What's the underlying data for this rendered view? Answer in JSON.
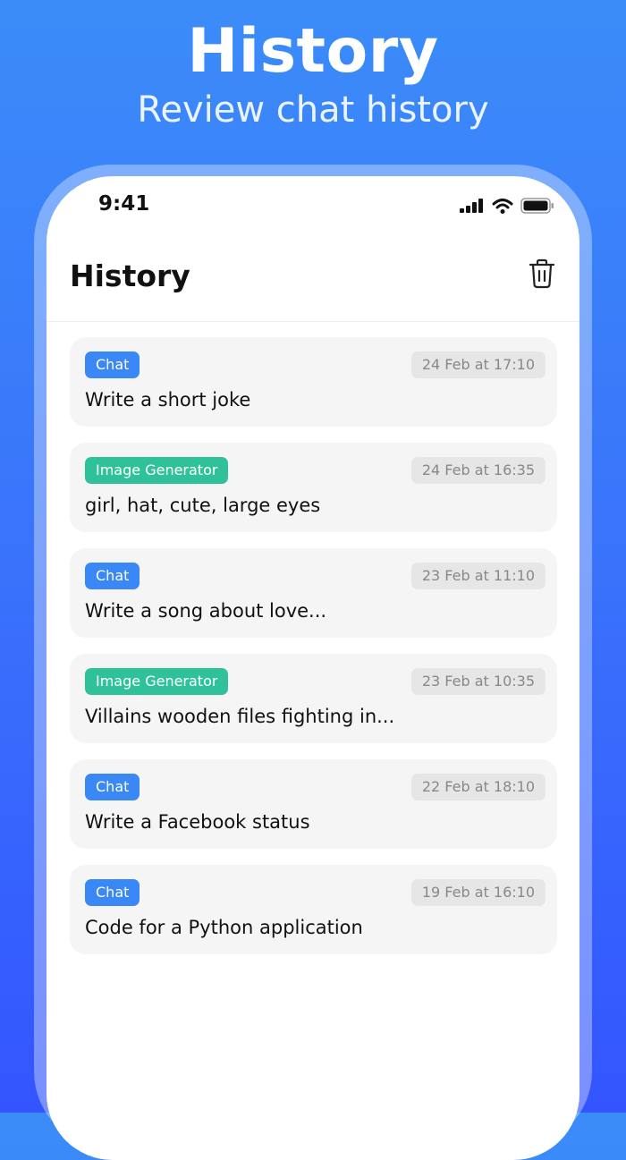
{
  "hero": {
    "title": "History",
    "subtitle": "Review chat history"
  },
  "status": {
    "time": "9:41"
  },
  "header": {
    "title": "History"
  },
  "items": [
    {
      "tag": "Chat",
      "type": "chat",
      "date": "24 Feb at 17:10",
      "text": "Write a short joke"
    },
    {
      "tag": "Image Generator",
      "type": "image",
      "date": "24 Feb at 16:35",
      "text": "girl, hat, cute, large eyes"
    },
    {
      "tag": "Chat",
      "type": "chat",
      "date": "23 Feb at 11:10",
      "text": "Write a song about love..."
    },
    {
      "tag": "Image Generator",
      "type": "image",
      "date": "23 Feb at 10:35",
      "text": "Villains wooden files fighting in..."
    },
    {
      "tag": "Chat",
      "type": "chat",
      "date": "22 Feb at 18:10",
      "text": "Write a Facebook status"
    },
    {
      "tag": "Chat",
      "type": "chat",
      "date": "19 Feb at 16:10",
      "text": "Code for a Python application"
    }
  ],
  "colors": {
    "chat_tag": "#3a87f6",
    "image_tag": "#2fc29a",
    "background": "#3a73fb"
  },
  "icons": {
    "delete": "trash-icon",
    "signal": "signal-icon",
    "wifi": "wifi-icon",
    "battery": "battery-icon"
  }
}
